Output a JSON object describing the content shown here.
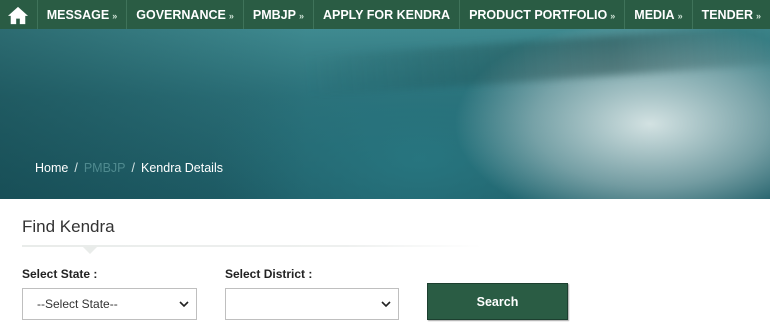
{
  "nav": {
    "home_icon": "home-icon",
    "items": [
      {
        "label": "MESSAGE",
        "has_dropdown": true
      },
      {
        "label": "GOVERNANCE",
        "has_dropdown": true
      },
      {
        "label": "PMBJP",
        "has_dropdown": true
      },
      {
        "label": "APPLY FOR KENDRA",
        "has_dropdown": false
      },
      {
        "label": "PRODUCT PORTFOLIO",
        "has_dropdown": true
      },
      {
        "label": "MEDIA",
        "has_dropdown": true
      },
      {
        "label": "TENDER",
        "has_dropdown": true
      }
    ],
    "dropdown_glyph": "»",
    "bg_color": "#2a5c44"
  },
  "breadcrumb": {
    "items": [
      "Home",
      "PMBJP",
      "Kendra Details"
    ],
    "separator": "/"
  },
  "find_kendra": {
    "title": "Find Kendra",
    "state": {
      "label": "Select State :",
      "value": "--Select State--"
    },
    "district": {
      "label": "Select District :",
      "value": ""
    },
    "search_label": "Search"
  },
  "colors": {
    "accent": "#2a5c44"
  }
}
